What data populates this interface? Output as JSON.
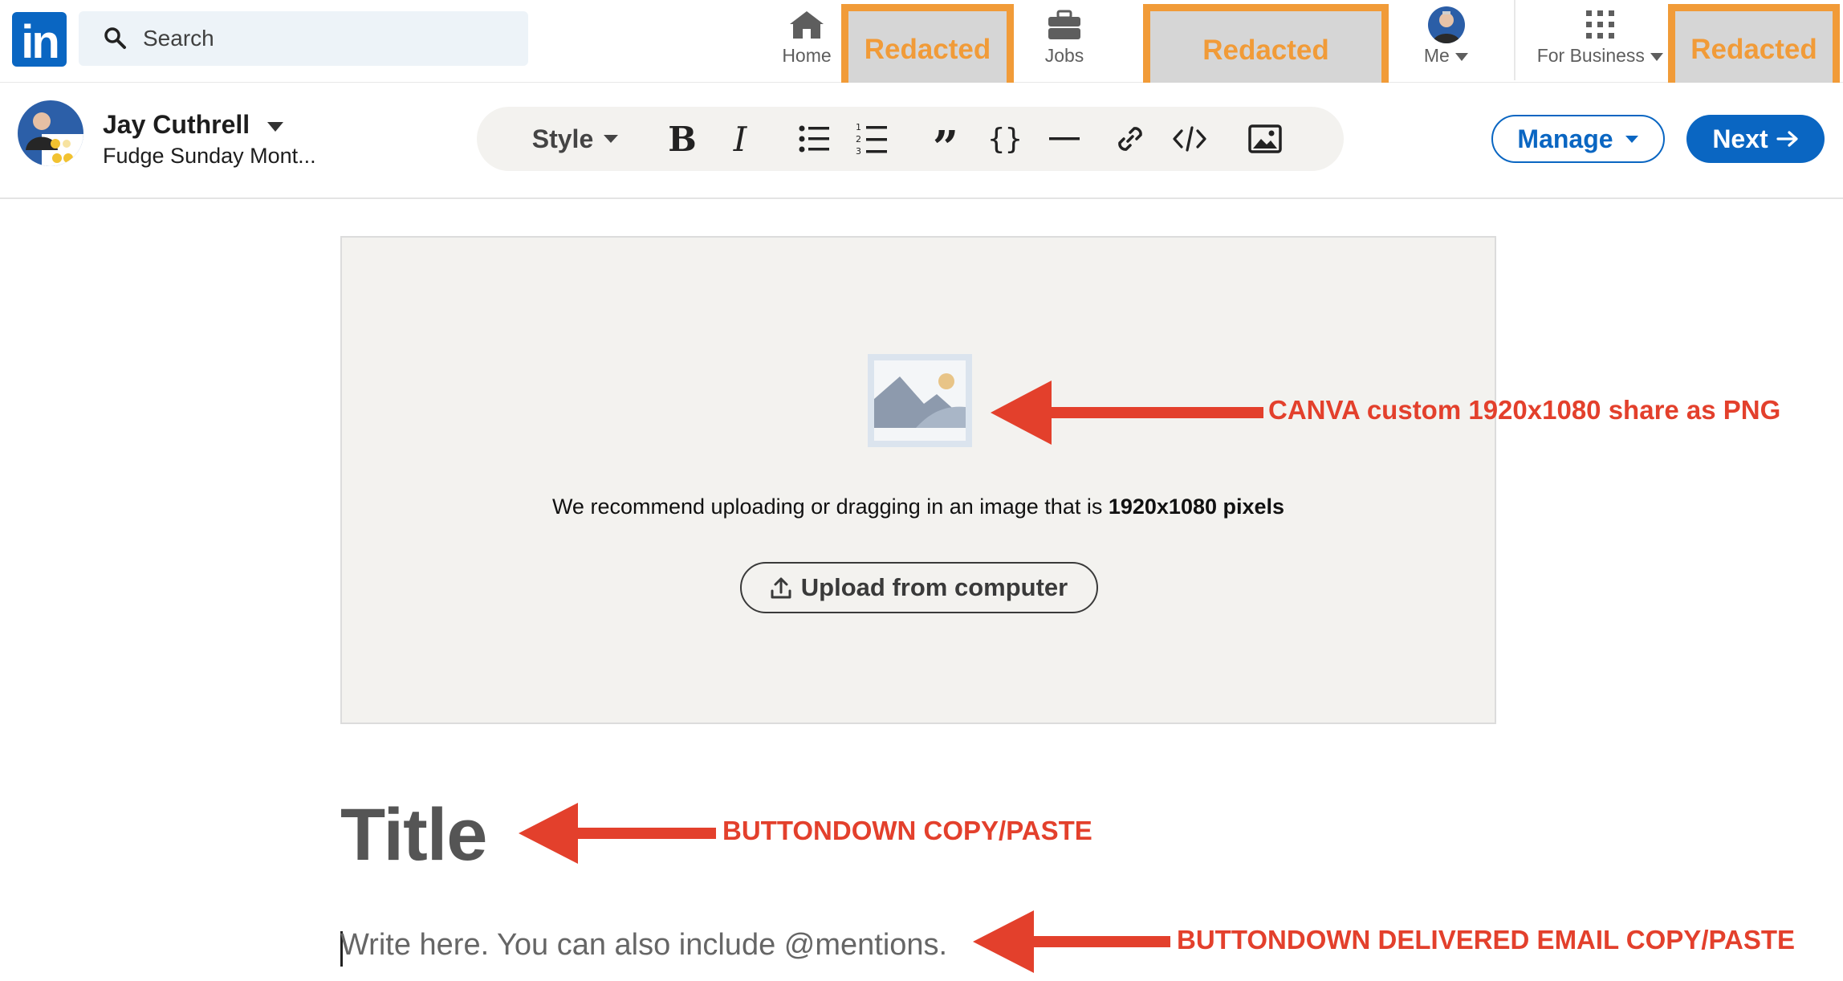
{
  "nav": {
    "logo_text": "in",
    "search_placeholder": "Search",
    "home_label": "Home",
    "jobs_label": "Jobs",
    "me_label": "Me",
    "business_label": "For Business",
    "redacted_1": "Redacted",
    "redacted_2": "Redacted",
    "redacted_3": "Redacted"
  },
  "editor": {
    "author_name": "Jay Cuthrell",
    "publication": "Fudge Sunday Mont...",
    "style_label": "Style",
    "tools": [
      "bold-icon",
      "italic-icon",
      "bulleted-list-icon",
      "numbered-list-icon",
      "quote-icon",
      "code-block-icon",
      "divider-icon",
      "link-icon",
      "embed-icon",
      "image-icon"
    ],
    "manage_label": "Manage",
    "next_label": "Next"
  },
  "cover": {
    "recommend_text": "We recommend uploading or dragging in an image that is ",
    "recommend_bold": "1920x1080 pixels",
    "upload_label": "Upload from computer"
  },
  "article": {
    "title_placeholder": "Title",
    "body_placeholder": "Write here. You can also include @mentions."
  },
  "annotations": {
    "cover_note": "CANVA custom 1920x1080 share as PNG",
    "title_note": "BUTTONDOWN COPY/PASTE",
    "body_note": "BUTTONDOWN DELIVERED EMAIL COPY/PASTE"
  },
  "colors": {
    "linkedin_blue": "#0a66c2",
    "redact_orange": "#f19b38",
    "annotation_red": "#e3402c"
  }
}
